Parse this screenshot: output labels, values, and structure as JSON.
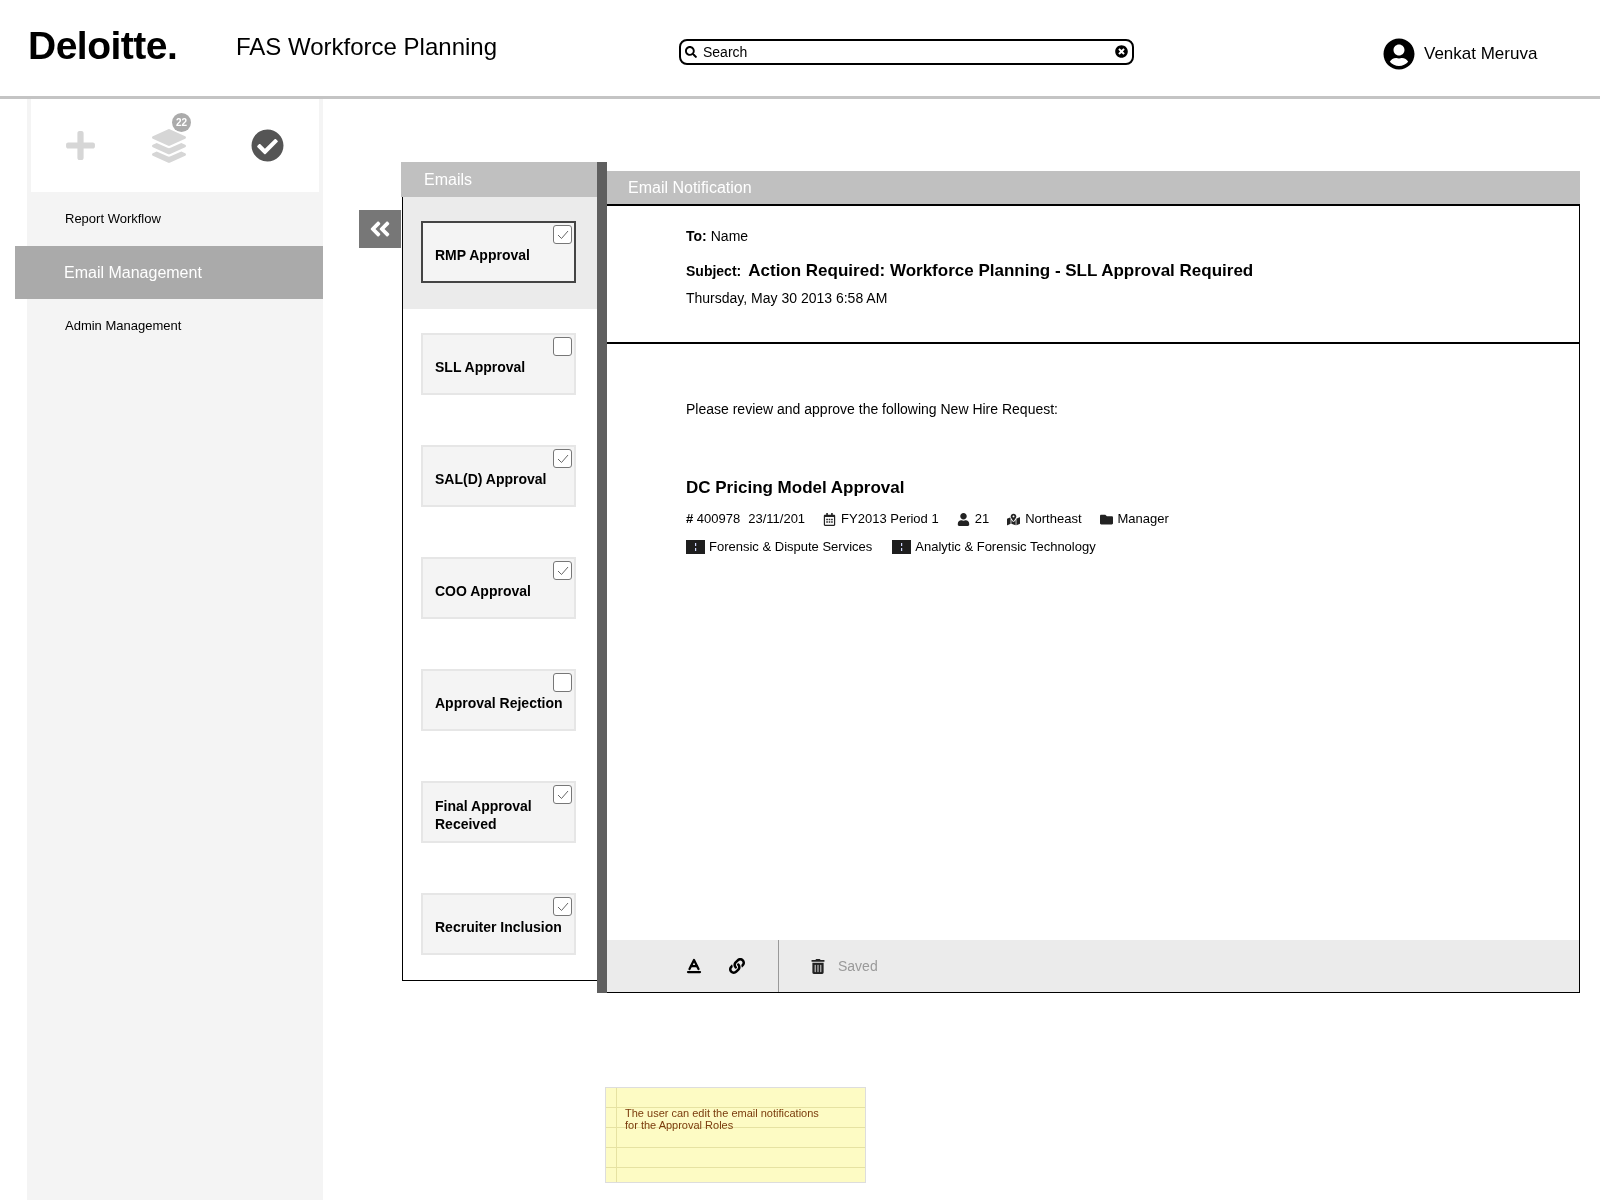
{
  "header": {
    "logo": "Deloitte.",
    "app_title": "FAS Workforce Planning",
    "search": {
      "placeholder": "Search"
    },
    "user": {
      "name": "Venkat Meruva"
    }
  },
  "sidebar": {
    "actions": [
      {
        "kind": "add",
        "active": false
      },
      {
        "kind": "layers",
        "active": false,
        "badge": "22"
      },
      {
        "kind": "approve",
        "active": true
      }
    ],
    "nav": [
      {
        "label": "Report Workflow",
        "selected": false
      },
      {
        "label": "Email Management",
        "selected": true
      },
      {
        "label": "Admin Management",
        "selected": false
      }
    ]
  },
  "emails": {
    "title": "Emails",
    "items": [
      {
        "label": "RMP Approval",
        "selected": true,
        "checked": true
      },
      {
        "label": "SLL Approval",
        "selected": false,
        "checked": false
      },
      {
        "label": "SAL(D) Approval",
        "selected": false,
        "checked": true
      },
      {
        "label": "COO Approval",
        "selected": false,
        "checked": true
      },
      {
        "label": "Approval Rejection",
        "selected": false,
        "checked": false
      },
      {
        "label": "Final Approval Received",
        "selected": false,
        "checked": true
      },
      {
        "label": "Recruiter Inclusion",
        "selected": false,
        "checked": true
      }
    ]
  },
  "notification": {
    "title": "Email Notification",
    "to_label": "To:",
    "to": "Name",
    "subject_label": "Subject:",
    "subject": "Action Required: Workforce Planning - SLL Approval Required",
    "date": "Thursday, May 30 2013 6:58 AM",
    "body": "Please review and approve the following New Hire Request:",
    "request": {
      "title": "DC Pricing Model Approval",
      "meta": [
        {
          "kind": "number",
          "text": "**#** 400978"
        },
        {
          "kind": "date",
          "text": "23/11/201"
        },
        {
          "kind": "period",
          "text": "FY2013 Period 1"
        },
        {
          "kind": "headcount",
          "text": "21"
        },
        {
          "kind": "region",
          "text": "Northeast"
        },
        {
          "kind": "level",
          "text": "Manager"
        }
      ],
      "tags": [
        "Forensic & Dispute Services",
        "Analytic & Forensic Technology"
      ]
    },
    "toolbar": {
      "status": "Saved"
    }
  },
  "note": {
    "text": "The user can edit the email notifications for the Approval Roles"
  }
}
